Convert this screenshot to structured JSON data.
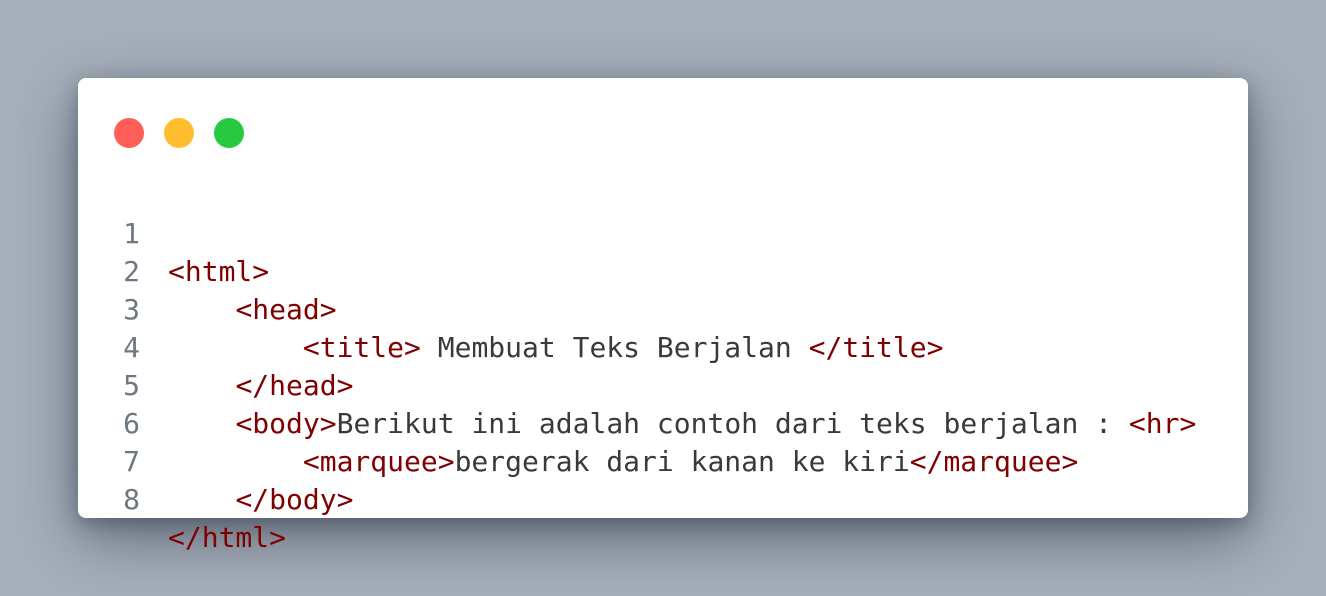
{
  "window": {
    "controls": [
      "close-button",
      "minimize-button",
      "maximize-button"
    ],
    "colors": {
      "close": "#ff5f56",
      "minimize": "#ffbd2e",
      "maximize": "#27c93f",
      "tag": "#7f0000",
      "text": "#3a3a3a",
      "line_number": "#6f7782"
    }
  },
  "code": {
    "lines": [
      {
        "number": "1",
        "indent": "",
        "parts": [
          {
            "t": "tag",
            "v": "<html>"
          }
        ]
      },
      {
        "number": "2",
        "indent": "    ",
        "parts": [
          {
            "t": "tag",
            "v": "<head>"
          }
        ]
      },
      {
        "number": "3",
        "indent": "        ",
        "parts": [
          {
            "t": "tag",
            "v": "<title>"
          },
          {
            "t": "txt",
            "v": " Membuat Teks Berjalan "
          },
          {
            "t": "tag",
            "v": "</title>"
          }
        ]
      },
      {
        "number": "4",
        "indent": "    ",
        "parts": [
          {
            "t": "tag",
            "v": "</head>"
          }
        ]
      },
      {
        "number": "5",
        "indent": "    ",
        "parts": [
          {
            "t": "tag",
            "v": "<body>"
          },
          {
            "t": "txt",
            "v": "Berikut ini adalah contoh dari teks berjalan : "
          },
          {
            "t": "tag",
            "v": "<hr>"
          }
        ]
      },
      {
        "number": "6",
        "indent": "        ",
        "parts": [
          {
            "t": "tag",
            "v": "<marquee>"
          },
          {
            "t": "txt",
            "v": "bergerak dari kanan ke kiri"
          },
          {
            "t": "tag",
            "v": "</marquee>"
          }
        ]
      },
      {
        "number": "7",
        "indent": "    ",
        "parts": [
          {
            "t": "tag",
            "v": "</body>"
          }
        ]
      },
      {
        "number": "8",
        "indent": "",
        "parts": [
          {
            "t": "tag",
            "v": "</html>"
          }
        ]
      }
    ]
  }
}
